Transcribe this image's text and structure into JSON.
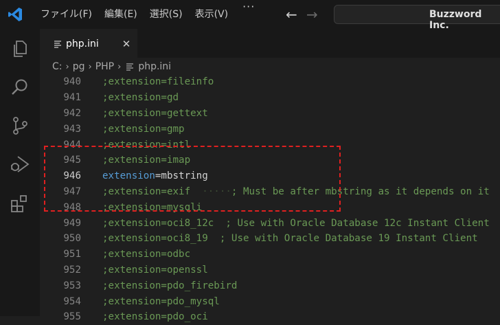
{
  "titlebar": {
    "menu": [
      "ファイル(F)",
      "編集(E)",
      "選択(S)",
      "表示(V)"
    ],
    "more": "···",
    "back_arrow": "←",
    "forward_arrow": "→",
    "search_text": "Buzzword Inc."
  },
  "tab": {
    "label": "php.ini",
    "close": "✕"
  },
  "breadcrumb": [
    "C:",
    "pg",
    "PHP",
    "php.ini"
  ],
  "breadcrumb_sep": "›",
  "lines": [
    {
      "n": "940",
      "text": ";extension=fileinfo"
    },
    {
      "n": "941",
      "text": ";extension=gd"
    },
    {
      "n": "942",
      "text": ";extension=gettext"
    },
    {
      "n": "943",
      "text": ";extension=gmp"
    },
    {
      "n": "944",
      "text": ";extension=intl"
    },
    {
      "n": "945",
      "text": ";extension=imap"
    },
    {
      "n": "946",
      "key": "extension",
      "eq": "=",
      "val": "mbstring"
    },
    {
      "n": "947",
      "text": ";extension=exif",
      "ws": "  ·····",
      "comment": "; Must be after mbstring as it depends on it"
    },
    {
      "n": "948",
      "text": ";extension=mysqli"
    },
    {
      "n": "949",
      "text": ";extension=oci8_12c  ; Use with Oracle Database 12c Instant Client"
    },
    {
      "n": "950",
      "text": ";extension=oci8_19  ; Use with Oracle Database 19 Instant Client"
    },
    {
      "n": "951",
      "text": ";extension=odbc"
    },
    {
      "n": "952",
      "text": ";extension=openssl"
    },
    {
      "n": "953",
      "text": ";extension=pdo_firebird"
    },
    {
      "n": "954",
      "text": ";extension=pdo_mysql"
    },
    {
      "n": "955",
      "text": ";extension=pdo_oci"
    }
  ],
  "colors": {
    "keyword": "#569cd6",
    "comment": "#6a9955",
    "highlight_box": "#e02020"
  }
}
